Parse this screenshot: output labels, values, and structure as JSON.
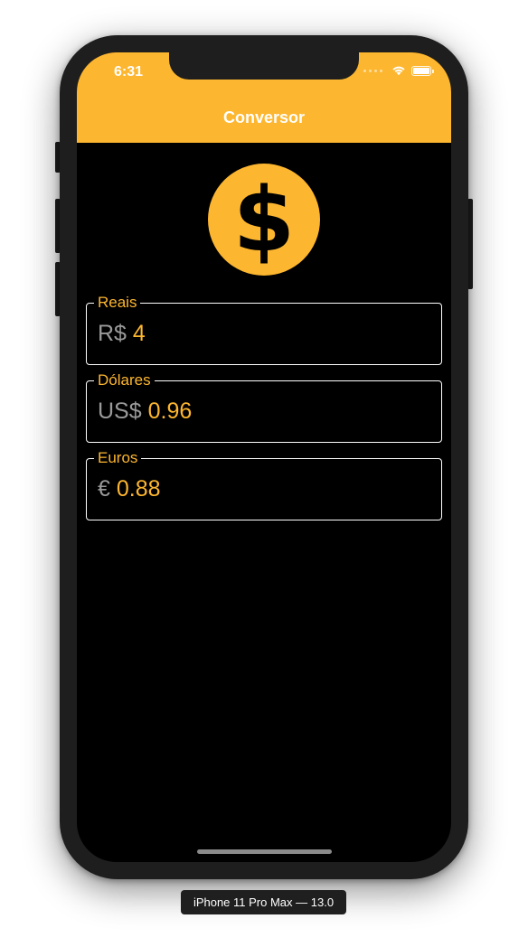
{
  "status_bar": {
    "time": "6:31"
  },
  "nav": {
    "title": "Conversor"
  },
  "logo": {
    "icon": "dollar-sign-icon",
    "color": "#fdb62f"
  },
  "fields": [
    {
      "label": "Reais",
      "prefix": "R$",
      "value": "4"
    },
    {
      "label": "Dólares",
      "prefix": "US$",
      "value": "0.96"
    },
    {
      "label": "Euros",
      "prefix": "€",
      "value": "0.88"
    }
  ],
  "device_label": "iPhone 11 Pro Max — 13.0",
  "colors": {
    "accent": "#fdb62f",
    "background": "#000000",
    "prefix_text": "#9a9a9a"
  }
}
